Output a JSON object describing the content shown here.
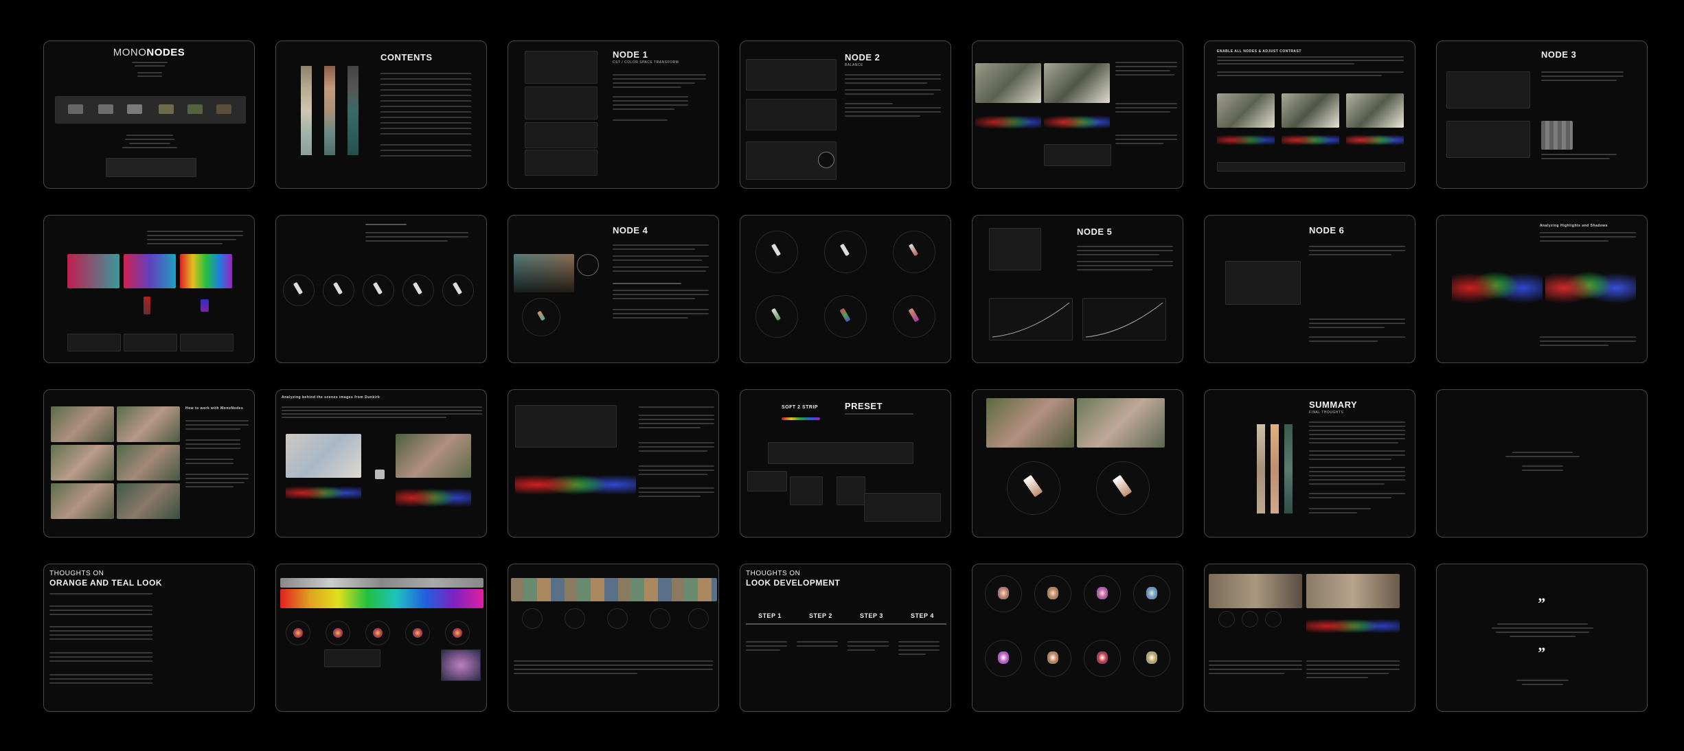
{
  "slides": {
    "s1": {
      "logo_a": "MONO",
      "logo_b": "NODES"
    },
    "s2": {
      "title": "CONTENTS"
    },
    "s3": {
      "title": "NODE 1",
      "subtitle": "CST / COLOR SPACE TRANSFORM"
    },
    "s4": {
      "title": "NODE 2",
      "subtitle": "BALANCE"
    },
    "s6": {
      "title": "ENABLE ALL NODES & ADJUST CONTRAST"
    },
    "s7": {
      "title": "NODE 3"
    },
    "s10": {
      "title": "NODE 4"
    },
    "s12": {
      "title": "NODE 5"
    },
    "s13": {
      "title": "NODE 6"
    },
    "s14": {
      "title": "Analyzing Highlights and Shadows"
    },
    "s15": {
      "title": "How to work with MonoNodes"
    },
    "s16": {
      "title": "Analyzing behind the scenes images from Dunkirk"
    },
    "s18": {
      "title": "PRESET",
      "thumb_a": "SOFT 2 STRIP"
    },
    "s20": {
      "title": "SUMMARY",
      "subtitle": "FINAL THOUGHTS"
    },
    "s22": {
      "title_a": "THOUGHTS ON",
      "title_b": "ORANGE AND TEAL LOOK"
    },
    "s25": {
      "title_a": "THOUGHTS ON",
      "title_b": "LOOK DEVELOPMENT",
      "steps": [
        "STEP 1",
        "STEP 2",
        "STEP 3",
        "STEP 4"
      ]
    },
    "s28": {
      "quote_mark": "”"
    }
  },
  "colors": {
    "background": "#000000",
    "slide_bg": "#0b0b0b",
    "slide_border": "#4a4a4a",
    "teal": "#2e5f5b",
    "orange": "#b08a6a"
  }
}
